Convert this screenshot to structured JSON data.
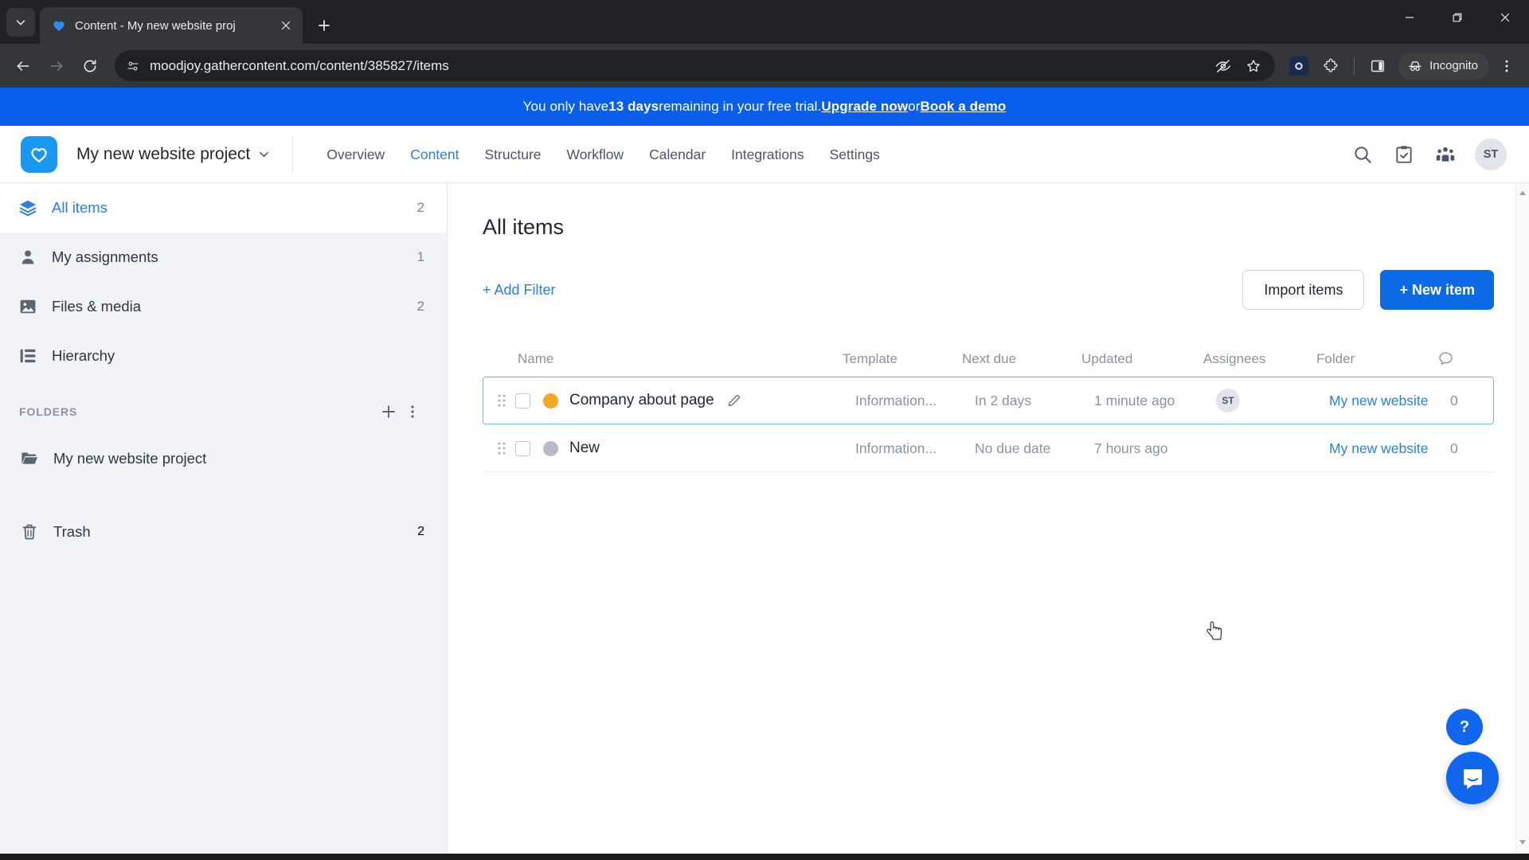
{
  "browser": {
    "tab": {
      "title": "Content - My new website proj",
      "favicon": "gathercontent-favicon"
    },
    "new_tab_label": "+",
    "url": "moodjoy.gathercontent.com/content/385827/items",
    "incognito_label": "Incognito",
    "icons": {
      "tab_list": "chevron-down-icon",
      "tab_close": "close-icon",
      "back": "back-arrow-icon",
      "forward": "forward-arrow-icon",
      "reload": "reload-icon",
      "site_info": "site-settings-icon",
      "tracking": "eye-off-icon",
      "bookmark": "star-icon",
      "extension_active": "extension-icon",
      "extensions": "puzzle-piece-icon",
      "side_panel": "side-panel-icon",
      "incognito": "incognito-icon",
      "menu": "three-dot-menu-icon",
      "minimize": "minimize-icon",
      "maximize": "maximize-icon",
      "close_window": "window-close-icon"
    }
  },
  "banner": {
    "prefix": "You only have ",
    "days": "13 days",
    "middle": " remaining in your free trial. ",
    "link_upgrade": "Upgrade now",
    "conjunction": " or ",
    "link_demo": "Book a demo",
    "bg_color": "#0a5eec"
  },
  "header": {
    "project_name": "My new website project",
    "nav": [
      {
        "label": "Overview",
        "active": false
      },
      {
        "label": "Content",
        "active": true
      },
      {
        "label": "Structure",
        "active": false
      },
      {
        "label": "Workflow",
        "active": false
      },
      {
        "label": "Calendar",
        "active": false
      },
      {
        "label": "Integrations",
        "active": false
      },
      {
        "label": "Settings",
        "active": false
      }
    ],
    "avatar_initials": "ST",
    "accent_color": "#2a7fe0",
    "logo_color": "#1a97f0"
  },
  "sidebar": {
    "items": [
      {
        "label": "All items",
        "count": "2",
        "icon": "layers-icon",
        "active": true
      },
      {
        "label": "My assignments",
        "count": "1",
        "icon": "person-icon",
        "active": false
      },
      {
        "label": "Files & media",
        "count": "2",
        "icon": "image-icon",
        "active": false
      },
      {
        "label": "Hierarchy",
        "count": "",
        "icon": "hierarchy-icon",
        "active": false
      }
    ],
    "folders_title": "FOLDERS",
    "folders": [
      {
        "label": "My new website project",
        "count": "",
        "icon": "folder-open-icon"
      }
    ],
    "trash": {
      "label": "Trash",
      "count": "2",
      "icon": "trash-icon"
    }
  },
  "main": {
    "title": "All items",
    "add_filter_label": "+ Add Filter",
    "import_label": "Import items",
    "new_item_label": "+ New item",
    "table": {
      "columns": [
        "Name",
        "Template",
        "Next due",
        "Updated",
        "Assignees",
        "Folder"
      ],
      "comments_icon": "comment-bubble-icon",
      "rows": [
        {
          "name": "Company about page",
          "status_color": "#f5a623",
          "template": "Information...",
          "next_due": "In 2 days",
          "updated": "1 minute ago",
          "assignee": "ST",
          "folder": "My new website",
          "comments": "0",
          "selected": true,
          "show_pencil": true
        },
        {
          "name": "New",
          "status_color": "#b6bcc6",
          "template": "Information...",
          "next_due": "No due date",
          "updated": "7 hours ago",
          "assignee": "",
          "folder": "My new website",
          "comments": "0",
          "selected": false,
          "show_pencil": false
        }
      ]
    }
  },
  "widgets": {
    "help_label": "?",
    "chat_icon": "intercom-chat-icon",
    "fab_color": "#1166ee"
  }
}
